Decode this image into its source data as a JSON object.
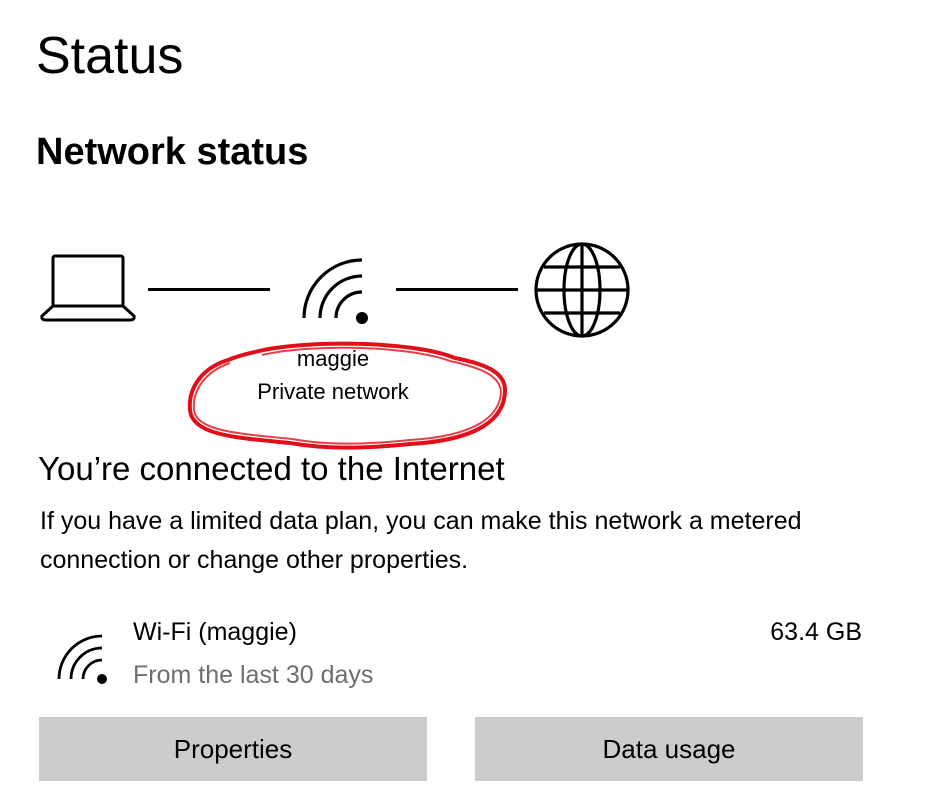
{
  "page": {
    "title": "Status"
  },
  "network_status": {
    "heading": "Network status",
    "network_name": "maggie",
    "network_type": "Private network",
    "icons": [
      "laptop-icon",
      "wifi-icon",
      "globe-icon"
    ]
  },
  "connection": {
    "heading": "You’re connected to the Internet",
    "description": "If you have a limited data plan, you can make this network a metered connection or change other properties.",
    "adapter_name": "Wi-Fi (maggie)",
    "period": "From the last 30 days",
    "usage": "63.4 GB",
    "icon": "wifi-icon"
  },
  "buttons": {
    "properties": "Properties",
    "data_usage": "Data usage"
  },
  "colors": {
    "annotation": "#e0101a",
    "button_bg": "#cccccc",
    "secondary_text": "#6e6e6e"
  }
}
